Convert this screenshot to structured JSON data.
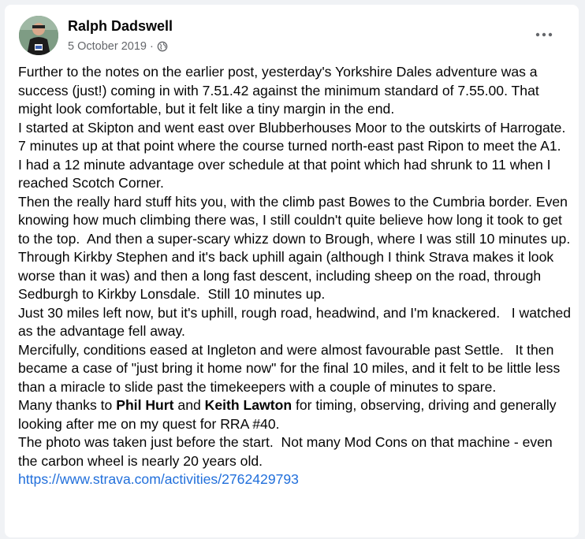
{
  "post": {
    "author": "Ralph Dadswell",
    "date": "5 October 2019",
    "separator": "·",
    "privacy_icon": "globe-icon",
    "more_icon": "more-options-icon",
    "paragraphs": [
      "Further to the notes on the earlier post, yesterday's Yorkshire Dales adventure was a success (just!) coming in with 7.51.42 against the minimum standard of 7.55.00. That might look comfortable, but it felt like a tiny margin in the end.",
      "I started at Skipton and went east over Blubberhouses Moor to the outskirts of Harrogate.  7 minutes up at that point where the course turned north-east past Ripon to meet the A1.  I had a 12 minute advantage over schedule at that point which had shrunk to 11 when I reached Scotch Corner.",
      "Then the really hard stuff hits you, with the climb past Bowes to the Cumbria border. Even knowing how much climbing there was, I still couldn't quite believe how long it took to get to the top.  And then a super-scary whizz down to Brough, where I was still 10 minutes up.   Through Kirkby Stephen and it's back uphill again (although I think Strava makes it look worse than it was) and then a long fast descent, including sheep on the road, through Sedburgh to Kirkby Lonsdale.  Still 10 minutes up.",
      "Just 30 miles left now, but it's uphill, rough road, headwind, and I'm knackered.   I watched as the advantage fell away.",
      "Mercifully, conditions eased at Ingleton and were almost favourable past Settle.   It then became a case of \"just bring it home now\" for the final 10 miles, and it felt to be little less than a miracle to slide past the timekeepers with a couple of minutes to spare."
    ],
    "thanks": {
      "prefix": "Many thanks to ",
      "person1": "Phil Hurt",
      "middle": " and ",
      "person2": "Keith Lawton",
      "suffix": " for timing, observing, driving and generally looking after me on my quest for RRA #40."
    },
    "photo_note": "The photo was taken just before the start.  Not many Mod Cons on that machine - even the carbon wheel is nearly 20 years old.",
    "link": "https://www.strava.com/activities/2762429793"
  },
  "colors": {
    "page_bg": "#f0f2f5",
    "card_bg": "#ffffff",
    "text": "#050505",
    "secondary_text": "#65676b",
    "link": "#216fdb"
  }
}
